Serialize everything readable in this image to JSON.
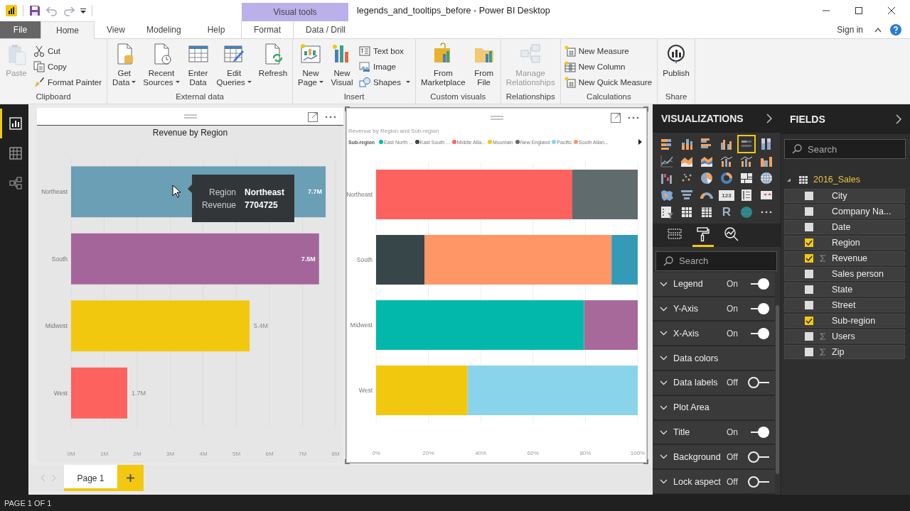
{
  "window": {
    "title": "legends_and_tooltips_before - Power BI Desktop",
    "context_tab_group": "Visual tools",
    "sign_in": "Sign in"
  },
  "ribbon_tabs": [
    {
      "label": "File",
      "kind": "file",
      "selected": false
    },
    {
      "label": "Home",
      "kind": "main",
      "selected": true
    },
    {
      "label": "View",
      "kind": "main",
      "selected": false
    },
    {
      "label": "Modeling",
      "kind": "main",
      "selected": false
    },
    {
      "label": "Help",
      "kind": "main",
      "selected": false
    },
    {
      "label": "Format",
      "kind": "context",
      "selected": false
    },
    {
      "label": "Data / Drill",
      "kind": "context",
      "selected": false
    }
  ],
  "ribbon_groups": [
    {
      "label": "Clipboard",
      "buttons": [
        {
          "label": "Paste",
          "kind": "paste",
          "dropdown": false,
          "disabled": true
        }
      ],
      "commands": [
        {
          "label": "Cut",
          "kind": "cut",
          "dropdown": false,
          "disabled": false
        },
        {
          "label": "Copy",
          "kind": "copy",
          "dropdown": false,
          "disabled": false
        },
        {
          "label": "Format Painter",
          "kind": "brush",
          "dropdown": false,
          "disabled": false
        }
      ]
    },
    {
      "label": "External data",
      "buttons": [
        {
          "label": "Get Data",
          "kind": "get-data",
          "dropdown": true,
          "disabled": false
        },
        {
          "label": "Recent Sources",
          "kind": "recent",
          "dropdown": true,
          "disabled": false
        },
        {
          "label": "Enter Data",
          "kind": "grid",
          "dropdown": false,
          "disabled": false
        },
        {
          "label": "Edit Queries",
          "kind": "edit",
          "dropdown": true,
          "disabled": false
        },
        {
          "label": "Refresh",
          "kind": "refresh",
          "dropdown": false,
          "disabled": false
        }
      ]
    },
    {
      "label": "Insert",
      "buttons": [
        {
          "label": "New Page",
          "kind": "new-page",
          "dropdown": true,
          "disabled": false
        },
        {
          "label": "New Visual",
          "kind": "new-visual",
          "dropdown": false,
          "disabled": false
        }
      ],
      "commands": [
        {
          "label": "Text box",
          "kind": "textbox",
          "dropdown": false,
          "disabled": false
        },
        {
          "label": "Image",
          "kind": "image",
          "dropdown": false,
          "disabled": false
        },
        {
          "label": "Shapes",
          "kind": "shapes",
          "dropdown": true,
          "disabled": false
        }
      ]
    },
    {
      "label": "Custom visuals",
      "buttons": [
        {
          "label": "From Marketplace",
          "kind": "marketplace",
          "dropdown": false,
          "disabled": false
        },
        {
          "label": "From File",
          "kind": "from-file",
          "dropdown": false,
          "disabled": false
        }
      ]
    },
    {
      "label": "Relationships",
      "buttons": [
        {
          "label": "Manage Relationships",
          "kind": "relationships",
          "dropdown": false,
          "disabled": true
        }
      ]
    },
    {
      "label": "Calculations",
      "commands": [
        {
          "label": "New Measure",
          "kind": "calc",
          "dropdown": false,
          "disabled": false
        },
        {
          "label": "New Column",
          "kind": "column",
          "dropdown": false,
          "disabled": false
        },
        {
          "label": "New Quick Measure",
          "kind": "calc",
          "dropdown": false,
          "disabled": false
        }
      ]
    },
    {
      "label": "Share",
      "buttons": [
        {
          "label": "Publish",
          "kind": "publish",
          "dropdown": false,
          "disabled": false
        }
      ]
    }
  ],
  "left_nav": [
    {
      "kind": "report",
      "selected": true
    },
    {
      "kind": "data",
      "selected": false
    },
    {
      "kind": "model",
      "selected": false
    }
  ],
  "visuals": [
    {
      "chart_data": {
        "type": "bar",
        "orientation": "horizontal",
        "title": "Revenue by Region",
        "categories": [
          "Northeast",
          "South",
          "Midwest",
          "West"
        ],
        "grid": true,
        "series": [
          {
            "values": [
              7.7,
              7.5,
              5.4,
              1.7
            ]
          }
        ],
        "colors": [
          "#6a9fb5",
          "#a4669a",
          "#f2c80f",
          "#fd625e"
        ],
        "xlim": [
          0,
          8
        ],
        "xticks": [
          {
            "value": 0,
            "label": "0M"
          },
          {
            "value": 1,
            "label": "1M"
          },
          {
            "value": 2,
            "label": "2M"
          },
          {
            "value": 3,
            "label": "3M"
          },
          {
            "value": 4,
            "label": "4M"
          },
          {
            "value": 5,
            "label": "5M"
          },
          {
            "value": 6,
            "label": "6M"
          },
          {
            "value": 7,
            "label": "7M"
          },
          {
            "value": 8,
            "label": "8M"
          }
        ],
        "value_labels": [
          "7.7M",
          "7.5M",
          "5.4M",
          "1.7M"
        ]
      },
      "selected": false,
      "tooltip": {
        "rows": [
          {
            "label": "Region",
            "value": "Northeast"
          },
          {
            "label": "Revenue",
            "value": "7704725"
          }
        ]
      }
    },
    {
      "chart_data": {
        "type": "bar",
        "orientation": "horizontal",
        "stacked": true,
        "title": "Revenue by Region and Sub-region",
        "legend_title": "Sub-region",
        "grid": true,
        "categories": [
          "Northeast",
          "South",
          "Midwest",
          "West"
        ],
        "series": [
          {
            "name": "East North ...",
            "color": "#01b8aa",
            "values": [
              null,
              null,
              79.5,
              null
            ]
          },
          {
            "name": "East South ...",
            "color": "#374649",
            "values": [
              null,
              18.5,
              null,
              null
            ]
          },
          {
            "name": "Middle Atla...",
            "color": "#fd625e",
            "values": [
              75,
              null,
              null,
              null
            ]
          },
          {
            "name": "Mountain",
            "color": "#f2c80f",
            "values": [
              null,
              null,
              null,
              35
            ]
          },
          {
            "name": "New England",
            "color": "#5f6b6d",
            "values": [
              25,
              null,
              null,
              null
            ]
          },
          {
            "name": "Pacific",
            "color": "#8ad4eb",
            "values": [
              null,
              null,
              null,
              65
            ]
          },
          {
            "name": "South Atlan...",
            "color": "#fe9666",
            "values": [
              null,
              71.5,
              null,
              null
            ]
          },
          {
            "color": "#3599b8",
            "values": [
              null,
              10,
              null,
              null
            ]
          },
          {
            "color": "#a66999",
            "values": [
              null,
              null,
              20.5,
              null
            ]
          }
        ],
        "xlim": [
          0,
          100
        ],
        "xticks": [
          {
            "value": 0,
            "label": "0%"
          },
          {
            "value": 20,
            "label": "20%"
          },
          {
            "value": 40,
            "label": "40%"
          },
          {
            "value": 60,
            "label": "60%"
          },
          {
            "value": 80,
            "label": "80%"
          },
          {
            "value": 100,
            "label": "100%"
          }
        ]
      },
      "selected": true
    }
  ],
  "pages": [
    {
      "label": "Page 1",
      "selected": true
    }
  ],
  "visualizations": {
    "title": "VISUALIZATIONS",
    "icons": [
      {
        "kind": "stacked-bar",
        "selected": false
      },
      {
        "kind": "stacked-column",
        "selected": false
      },
      {
        "kind": "clustered-bar",
        "selected": false
      },
      {
        "kind": "clustered-column",
        "selected": false
      },
      {
        "kind": "bar-100",
        "selected": true
      },
      {
        "kind": "column-100",
        "selected": false
      },
      {
        "kind": "line",
        "selected": false
      },
      {
        "kind": "area",
        "selected": false
      },
      {
        "kind": "stacked-area",
        "selected": false
      },
      {
        "kind": "line-column",
        "selected": false
      },
      {
        "kind": "line-column",
        "selected": false
      },
      {
        "kind": "ribbon",
        "selected": false
      },
      {
        "kind": "waterfall",
        "selected": false
      },
      {
        "kind": "scatter",
        "selected": false
      },
      {
        "kind": "pie",
        "selected": false
      },
      {
        "kind": "donut",
        "selected": false
      },
      {
        "kind": "treemap",
        "selected": false
      },
      {
        "kind": "globe",
        "selected": false
      },
      {
        "kind": "filled-map",
        "selected": false
      },
      {
        "kind": "funnel",
        "selected": false
      },
      {
        "kind": "gauge",
        "selected": false
      },
      {
        "kind": "card",
        "glyph": "123",
        "selected": false
      },
      {
        "kind": "multi-card",
        "selected": false
      },
      {
        "kind": "kpi",
        "selected": false
      },
      {
        "kind": "slicer",
        "selected": false
      },
      {
        "kind": "table",
        "selected": false
      },
      {
        "kind": "matrix",
        "selected": false
      },
      {
        "kind": "letter",
        "glyph": "R",
        "selected": false
      },
      {
        "kind": "globe-green",
        "selected": false
      },
      {
        "kind": "more",
        "selected": false
      }
    ],
    "pane_tabs": [
      {
        "kind": "fields",
        "selected": false
      },
      {
        "kind": "format",
        "selected": true
      },
      {
        "kind": "analytics",
        "selected": false
      }
    ],
    "search": {
      "placeholder": "Search"
    },
    "sections": [
      {
        "label": "Legend",
        "kind": "toggle",
        "state": "On",
        "on": true
      },
      {
        "label": "Y-Axis",
        "kind": "toggle",
        "state": "On",
        "on": true
      },
      {
        "label": "X-Axis",
        "kind": "toggle",
        "state": "On",
        "on": true
      },
      {
        "label": "Data colors",
        "kind": "section"
      },
      {
        "label": "Data labels",
        "kind": "toggle",
        "state": "Off",
        "on": false
      },
      {
        "label": "Plot Area",
        "kind": "section"
      },
      {
        "label": "Title",
        "kind": "toggle",
        "state": "On",
        "on": true
      },
      {
        "label": "Background",
        "kind": "toggle",
        "state": "Off",
        "on": false
      },
      {
        "label": "Lock aspect",
        "kind": "toggle",
        "state": "Off",
        "on": false
      }
    ]
  },
  "fields": {
    "title": "FIELDS",
    "search": {
      "placeholder": "Search"
    },
    "tables": [
      {
        "name": "2016_Sales",
        "expanded": true,
        "children": [
          {
            "name": "City",
            "kind": "column",
            "checked": false
          },
          {
            "name": "Company Na...",
            "kind": "column",
            "checked": false
          },
          {
            "name": "Date",
            "kind": "column",
            "checked": false
          },
          {
            "name": "Region",
            "kind": "column",
            "checked": true
          },
          {
            "name": "Revenue",
            "kind": "measure",
            "checked": true
          },
          {
            "name": "Sales person",
            "kind": "column",
            "checked": false
          },
          {
            "name": "State",
            "kind": "column",
            "checked": false
          },
          {
            "name": "Street",
            "kind": "column",
            "checked": false
          },
          {
            "name": "Sub-region",
            "kind": "column",
            "checked": true
          },
          {
            "name": "Users",
            "kind": "measure",
            "checked": false
          },
          {
            "name": "Zip",
            "kind": "measure",
            "checked": false
          }
        ]
      }
    ]
  },
  "status_bar": "PAGE 1 OF 1"
}
